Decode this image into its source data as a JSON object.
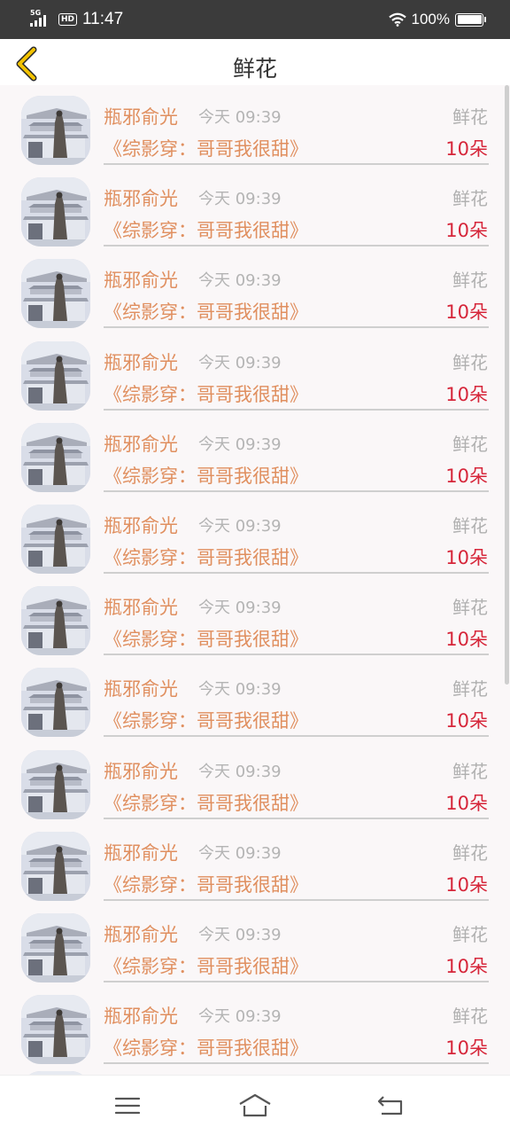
{
  "status_bar": {
    "network": "5G",
    "hd_badge": "HD",
    "time": "11:47",
    "battery": "100%"
  },
  "nav": {
    "title": "鲜花",
    "back_icon": "chevron-left-icon"
  },
  "list": {
    "items": [
      {
        "name": "瓶邪俞光",
        "time": "今天 09:39",
        "gift": "鲜花",
        "book": "《综影穿：哥哥我很甜》",
        "count": "10朵"
      },
      {
        "name": "瓶邪俞光",
        "time": "今天 09:39",
        "gift": "鲜花",
        "book": "《综影穿：哥哥我很甜》",
        "count": "10朵"
      },
      {
        "name": "瓶邪俞光",
        "time": "今天 09:39",
        "gift": "鲜花",
        "book": "《综影穿：哥哥我很甜》",
        "count": "10朵"
      },
      {
        "name": "瓶邪俞光",
        "time": "今天 09:39",
        "gift": "鲜花",
        "book": "《综影穿：哥哥我很甜》",
        "count": "10朵"
      },
      {
        "name": "瓶邪俞光",
        "time": "今天 09:39",
        "gift": "鲜花",
        "book": "《综影穿：哥哥我很甜》",
        "count": "10朵"
      },
      {
        "name": "瓶邪俞光",
        "time": "今天 09:39",
        "gift": "鲜花",
        "book": "《综影穿：哥哥我很甜》",
        "count": "10朵"
      },
      {
        "name": "瓶邪俞光",
        "time": "今天 09:39",
        "gift": "鲜花",
        "book": "《综影穿：哥哥我很甜》",
        "count": "10朵"
      },
      {
        "name": "瓶邪俞光",
        "time": "今天 09:39",
        "gift": "鲜花",
        "book": "《综影穿：哥哥我很甜》",
        "count": "10朵"
      },
      {
        "name": "瓶邪俞光",
        "time": "今天 09:39",
        "gift": "鲜花",
        "book": "《综影穿：哥哥我很甜》",
        "count": "10朵"
      },
      {
        "name": "瓶邪俞光",
        "time": "今天 09:39",
        "gift": "鲜花",
        "book": "《综影穿：哥哥我很甜》",
        "count": "10朵"
      },
      {
        "name": "瓶邪俞光",
        "time": "今天 09:39",
        "gift": "鲜花",
        "book": "《综影穿：哥哥我很甜》",
        "count": "10朵"
      },
      {
        "name": "瓶邪俞光",
        "time": "今天 09:39",
        "gift": "鲜花",
        "book": "《综影穿：哥哥我很甜》",
        "count": "10朵"
      }
    ]
  },
  "colors": {
    "name": "#e08f5f",
    "count": "#d6263a",
    "muted": "#b4b4b4",
    "back_arrow": "#e6b000"
  },
  "bottom_nav": {
    "menu_icon": "menu-icon",
    "home_icon": "home-icon",
    "back_icon": "return-icon"
  }
}
